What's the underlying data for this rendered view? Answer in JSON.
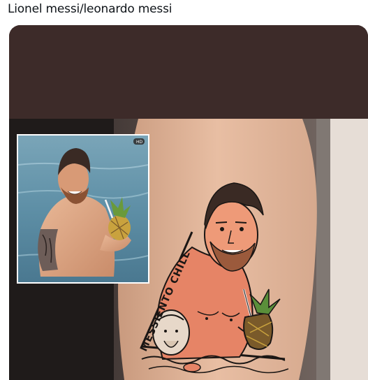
{
  "tweet": {
    "text": "Lionel messi/leonardo messi"
  },
  "media": {
    "description_free": true,
    "tattoo_caption": "MESSIENTO CHILL",
    "inset_badge": "HD",
    "colors": {
      "top_band": "#3d2b29",
      "skin": "#e4b090",
      "water": "#5e8fa6",
      "tattoo_outline": "#1a1614"
    }
  }
}
